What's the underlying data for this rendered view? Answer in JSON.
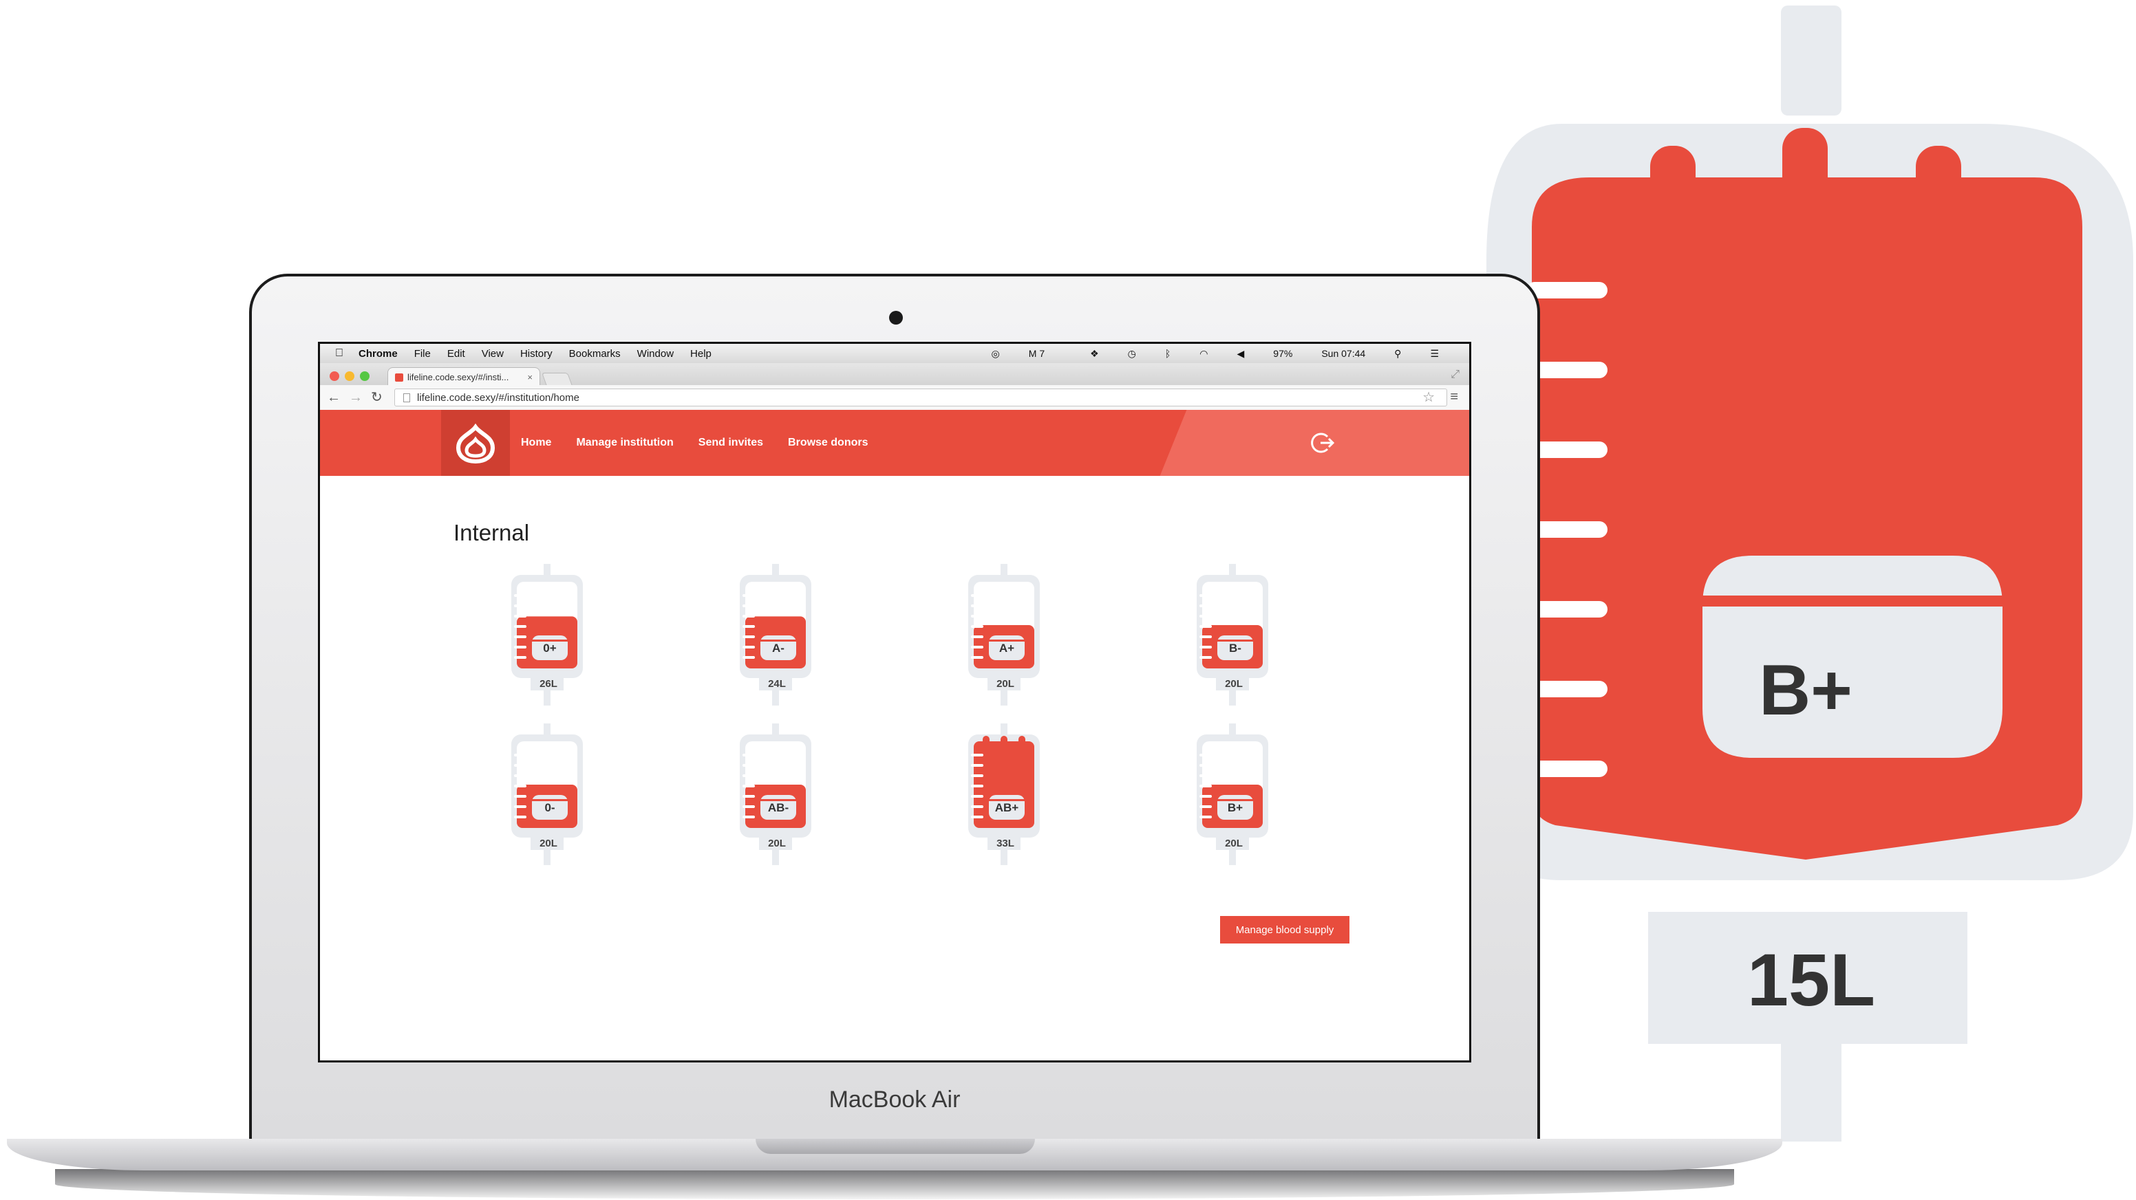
{
  "illustration": {
    "blood_type": "B+",
    "volume": "15L"
  },
  "laptop": {
    "brand": "MacBook Air"
  },
  "menubar": {
    "apple": "",
    "app_name": "Chrome",
    "items": [
      "File",
      "Edit",
      "View",
      "History",
      "Bookmarks",
      "Window",
      "Help"
    ],
    "status": {
      "counter": "7",
      "battery": "97%",
      "clock": "Sun 07:44"
    }
  },
  "browser": {
    "tab_title": "lifeline.code.sexy/#/insti...",
    "tab_close": "×",
    "url": "lifeline.code.sexy/#/institution/home"
  },
  "app": {
    "nav": [
      "Home",
      "Manage institution",
      "Send invites",
      "Browse donors"
    ],
    "section_title": "Internal",
    "bags": [
      {
        "type": "0+",
        "volume": "26L",
        "fill": 0.6
      },
      {
        "type": "A-",
        "volume": "24L",
        "fill": 0.6
      },
      {
        "type": "A+",
        "volume": "20L",
        "fill": 0.5
      },
      {
        "type": "B-",
        "volume": "20L",
        "fill": 0.5
      },
      {
        "type": "0-",
        "volume": "20L",
        "fill": 0.5
      },
      {
        "type": "AB-",
        "volume": "20L",
        "fill": 0.5
      },
      {
        "type": "AB+",
        "volume": "33L",
        "fill": 1.0
      },
      {
        "type": "B+",
        "volume": "20L",
        "fill": 0.5
      }
    ],
    "manage_button": "Manage blood supply"
  },
  "colors": {
    "accent": "#e84c3d",
    "accent_dark": "#cf3f31",
    "bag_outline": "#e8ebef",
    "text_dark": "#333333"
  }
}
